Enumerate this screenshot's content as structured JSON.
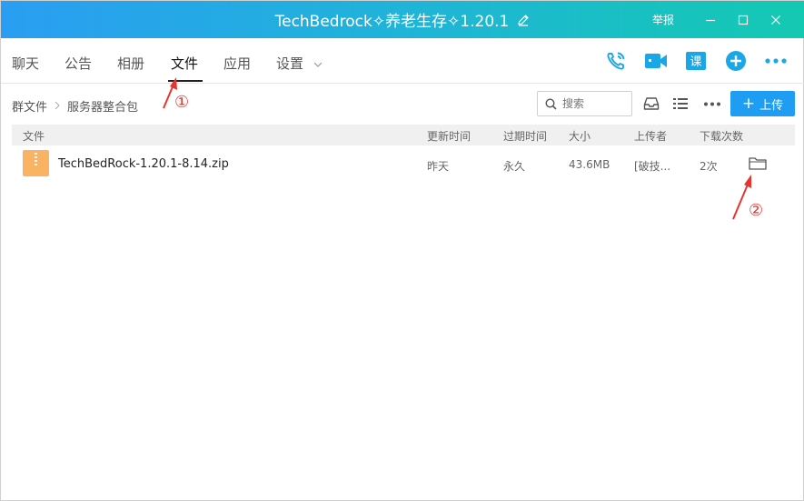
{
  "window": {
    "title": "TechBedrock✧养老生存✧1.20.1",
    "report_label": "举报"
  },
  "tabs": [
    {
      "label": "聊天"
    },
    {
      "label": "公告"
    },
    {
      "label": "相册"
    },
    {
      "label": "文件",
      "active": true
    },
    {
      "label": "应用"
    },
    {
      "label": "设置"
    }
  ],
  "toolbar_icons": [
    "phone-icon",
    "video-icon",
    "class-icon",
    "add-icon",
    "more-icon"
  ],
  "class_icon_text": "课",
  "breadcrumb": [
    "群文件",
    "服务器整合包"
  ],
  "search": {
    "placeholder": "搜索"
  },
  "upload_label": "上传",
  "table": {
    "columns": [
      "文件",
      "更新时间",
      "过期时间",
      "大小",
      "上传者",
      "下载次数"
    ],
    "rows": [
      {
        "name": "TechBedRock-1.20.1-8.14.zip",
        "updated": "昨天",
        "expires": "永久",
        "size": "43.6MB",
        "uploader": "[破技...",
        "downloads": "2次"
      }
    ]
  },
  "annotations": {
    "first": "①",
    "second": "②"
  },
  "colors": {
    "accent": "#1e9df2",
    "annotation": "#e8342f",
    "file_icon": "#f9b363"
  }
}
